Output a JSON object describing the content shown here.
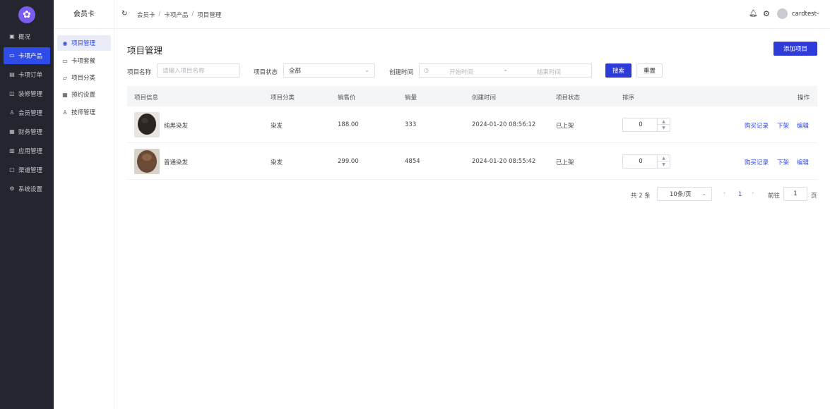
{
  "nav": {
    "items": [
      {
        "label": "概况",
        "icon": "dashboard-icon"
      },
      {
        "label": "卡项产品",
        "icon": "card-icon",
        "active": true
      },
      {
        "label": "卡项订单",
        "icon": "order-icon"
      },
      {
        "label": "装修管理",
        "icon": "decorate-icon"
      },
      {
        "label": "会员管理",
        "icon": "user-icon"
      },
      {
        "label": "财务管理",
        "icon": "finance-icon"
      },
      {
        "label": "应用管理",
        "icon": "apps-icon"
      },
      {
        "label": "渠道管理",
        "icon": "channel-icon"
      },
      {
        "label": "系统设置",
        "icon": "settings-icon"
      }
    ]
  },
  "subnav": {
    "title": "会员卡",
    "items": [
      {
        "label": "项目管理",
        "active": true
      },
      {
        "label": "卡项套餐"
      },
      {
        "label": "项目分类"
      },
      {
        "label": "预约设置"
      },
      {
        "label": "技师管理"
      }
    ]
  },
  "header": {
    "breadcrumb": [
      "会员卡",
      "卡项产品",
      "项目管理"
    ],
    "username": "cardtest"
  },
  "main": {
    "title": "项目管理",
    "add_label": "添加项目",
    "filters": {
      "name_label": "项目名称",
      "name_placeholder": "请输入项目名称",
      "status_label": "项目状态",
      "status_value": "全部",
      "date_label": "创建时间",
      "date_start": "开始时间",
      "date_sep": "-",
      "date_end": "结束时间",
      "search_label": "搜索",
      "reset_label": "重置"
    },
    "table": {
      "headers": {
        "info": "项目信息",
        "category": "项目分类",
        "price": "销售价",
        "sales": "销量",
        "created": "创建时间",
        "status": "项目状态",
        "sort": "排序",
        "ops": "操作"
      },
      "rows": [
        {
          "name": "纯黑染发",
          "category": "染发",
          "price": "188.00",
          "sales": "333",
          "created": "2024-01-20 08:56:12",
          "status": "已上架",
          "sort": "0",
          "op1": "购买记录",
          "op2": "下架",
          "op3": "编辑",
          "thumb_color": "#2b2522"
        },
        {
          "name": "普通染发",
          "category": "染发",
          "price": "299.00",
          "sales": "4854",
          "created": "2024-01-20 08:55:42",
          "status": "已上架",
          "sort": "0",
          "op1": "购买记录",
          "op2": "下架",
          "op3": "编辑",
          "thumb_color": "#6b4a36"
        }
      ]
    },
    "pagination": {
      "total": "共 2 条",
      "page_size": "10条/页",
      "current": "1",
      "goto_label": "前往",
      "goto_value": "1",
      "page_unit": "页"
    }
  },
  "colors": {
    "primary": "#2f3bd9",
    "nav_bg": "#23262e",
    "link": "#2f4be8"
  }
}
